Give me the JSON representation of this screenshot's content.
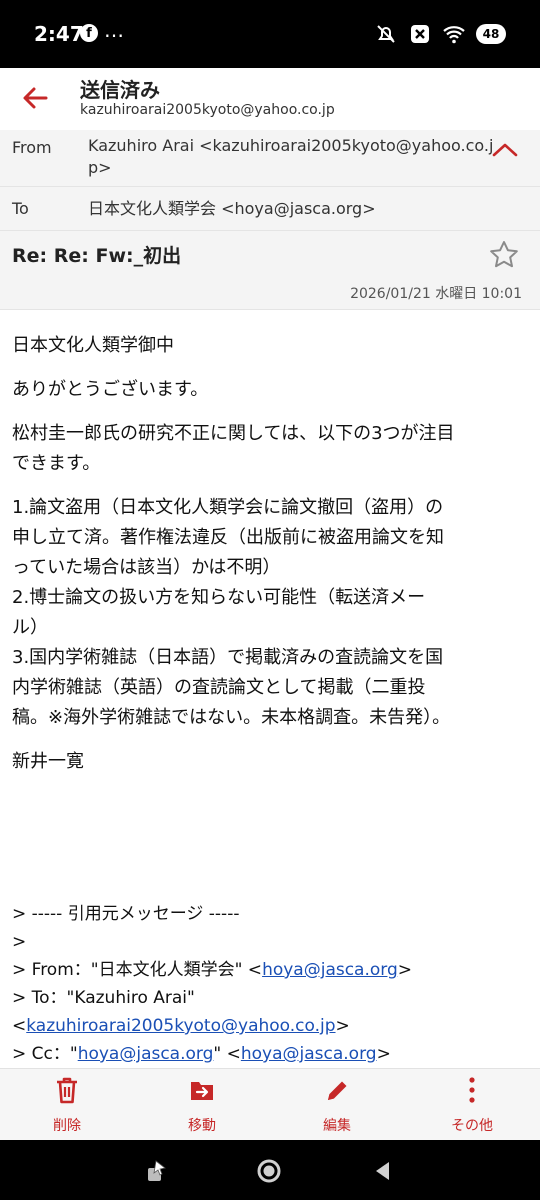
{
  "status": {
    "time": "2:47",
    "fb_glyph": "f",
    "dots": "…",
    "battery": "48"
  },
  "header": {
    "title": "送信済み",
    "account": "kazuhiroarai2005kyoto@yahoo.co.jp"
  },
  "meta": {
    "from_label": "From",
    "from_value": "Kazuhiro Arai <kazuhiroarai2005kyoto@yahoo.co.jp>",
    "to_label": "To",
    "to_value": "日本文化人類学会 <hoya@jasca.org>"
  },
  "subject": {
    "text": "Re: Re: Fw:_初出",
    "date": "2026/01/21 水曜日 10:01"
  },
  "body": {
    "p1": "日本文化人類学御中",
    "p2": "ありがとうございます。",
    "p3_l1": "松村圭一郎氏の研究不正に関しては、以下の3つが注目",
    "p3_l2": "できます。",
    "p4_l1": "1.論文盗用（日本文化人類学会に論文撤回（盗用）の",
    "p4_l2": "申し立て済。著作権法違反（出版前に被盗用論文を知",
    "p4_l3": "っていた場合は該当）かは不明）",
    "p4_l4": "2.博士論文の扱い方を知らない可能性（転送済メー",
    "p4_l5": "ル）",
    "p4_l6": "3.国内学術雑誌（日本語）で掲載済みの査読論文を国",
    "p4_l7": "内学術雑誌（英語）の査読論文として掲載（二重投",
    "p4_l8": "稿。※海外学術雑誌ではない。未本格調査。未告発）。",
    "p5": "新井一寛"
  },
  "quote": {
    "header": "> ----- 引用元メッセージ -----",
    "blank": ">",
    "from_prefix": "> From：\"日本文化人類学会\" <",
    "from_link": "hoya@jasca.org",
    "from_suffix": ">",
    "to_line": "> To：\"Kazuhiro Arai\"",
    "to_open": "<",
    "to_link": "kazuhiroarai2005kyoto@yahoo.co.jp",
    "to_close": ">",
    "cc_prefix": "> Cc：\"",
    "cc_link1": "hoya@jasca.org",
    "cc_mid": "\" <",
    "cc_link2": "hoya@jasca.org",
    "cc_suffix": ">"
  },
  "toolbar": {
    "delete": "削除",
    "move": "移動",
    "edit": "編集",
    "more": "その他"
  },
  "colors": {
    "accent": "#c62828",
    "link": "#1a4fb5",
    "meta_bg": "#f4f4f4"
  }
}
